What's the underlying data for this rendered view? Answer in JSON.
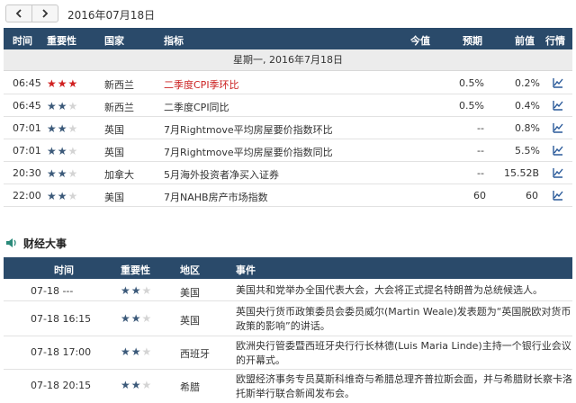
{
  "datebar": {
    "date": "2016年07月18日",
    "prev_icon": "chevron-left-icon",
    "next_icon": "chevron-right-icon"
  },
  "calendar": {
    "headers": {
      "time": "时间",
      "importance": "重要性",
      "country": "国家",
      "indicator": "指标",
      "actual": "今值",
      "forecast": "预期",
      "previous": "前值",
      "chart": "行情"
    },
    "day_label": "星期一, 2016年7月18日",
    "rows": [
      {
        "time": "06:45",
        "stars": 3,
        "red": true,
        "country": "新西兰",
        "indicator": "二季度CPI季环比",
        "actual": "",
        "forecast": "0.5%",
        "previous": "0.2%"
      },
      {
        "time": "06:45",
        "stars": 2,
        "red": false,
        "country": "新西兰",
        "indicator": "二季度CPI同比",
        "actual": "",
        "forecast": "0.5%",
        "previous": "0.4%"
      },
      {
        "time": "07:01",
        "stars": 2,
        "red": false,
        "country": "英国",
        "indicator": "7月Rightmove平均房屋要价指数环比",
        "actual": "",
        "forecast": "--",
        "previous": "0.8%"
      },
      {
        "time": "07:01",
        "stars": 2,
        "red": false,
        "country": "英国",
        "indicator": "7月Rightmove平均房屋要价指数同比",
        "actual": "",
        "forecast": "--",
        "previous": "5.5%"
      },
      {
        "time": "20:30",
        "stars": 2,
        "red": false,
        "country": "加拿大",
        "indicator": "5月海外投资者净买入证券",
        "actual": "",
        "forecast": "--",
        "previous": "15.52B"
      },
      {
        "time": "22:00",
        "stars": 2,
        "red": false,
        "country": "美国",
        "indicator": "7月NAHB房产市场指数",
        "actual": "",
        "forecast": "60",
        "previous": "60"
      }
    ]
  },
  "events": {
    "section_title": "财经大事",
    "section_icon": "speaker-icon",
    "headers": {
      "time": "时间",
      "importance": "重要性",
      "region": "地区",
      "event": "事件"
    },
    "rows": [
      {
        "time": "07-18 ---",
        "stars": 2,
        "region": "美国",
        "event": "美国共和党举办全国代表大会，大会将正式提名特朗普为总统候选人。"
      },
      {
        "time": "07-18 16:15",
        "stars": 2,
        "region": "英国",
        "event": "英国央行货币政策委员会委员威尔(Martin Weale)发表题为“英国脱欧对货币政策的影响”的讲话。"
      },
      {
        "time": "07-18 17:00",
        "stars": 2,
        "region": "西班牙",
        "event": "欧洲央行管委暨西班牙央行行长林德(Luis Maria Linde)主持一个银行业会议的开幕式。"
      },
      {
        "time": "07-18 20:15",
        "stars": 2,
        "region": "希腊",
        "event": "欧盟经济事务专员莫斯科维奇与希腊总理齐普拉斯会面，并与希腊财长察卡洛托斯举行联合新闻发布会。"
      }
    ]
  },
  "colors": {
    "header_bg": "#2a4a6a",
    "star_on": "#3c5a7a",
    "star_red": "#d02020",
    "alert_text": "#cc2222"
  }
}
